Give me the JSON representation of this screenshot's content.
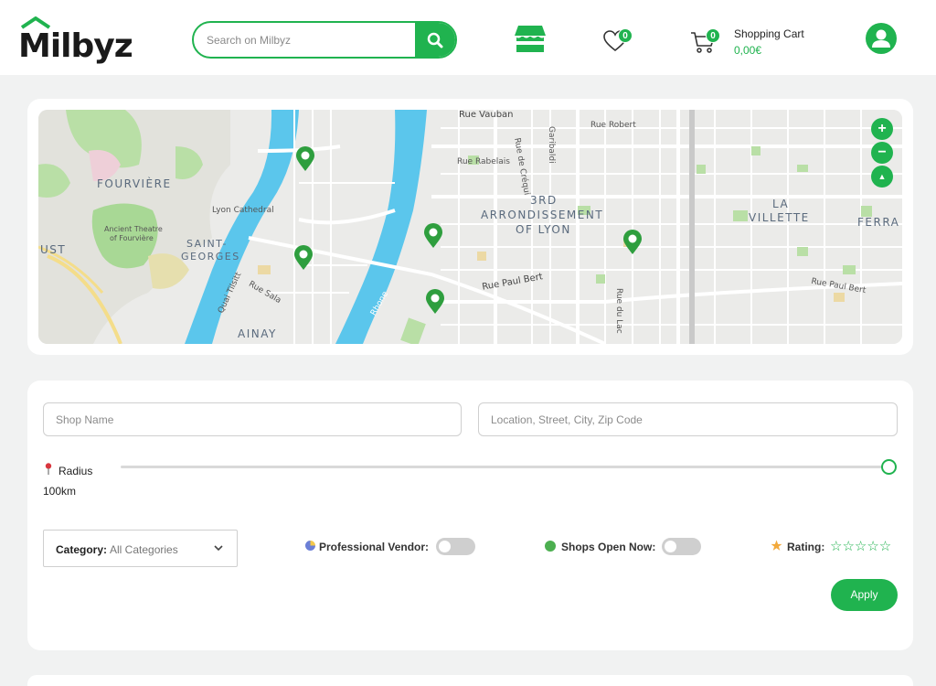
{
  "header": {
    "logo_text": "Milbyz",
    "search_placeholder": "Search on Milbyz",
    "wishlist_count": "0",
    "cart_count": "0",
    "cart_label": "Shopping Cart",
    "cart_total": "0,00€"
  },
  "map": {
    "streets": [
      "Rue Vauban",
      "Rue Robert",
      "Garibaldi",
      "Rue de Créqui",
      "Rue Rabelais",
      "Rue Paul Bert",
      "Rue du Lac",
      "Rue Paul Bert",
      "Quai Tilsitt",
      "Rue Sala",
      "Rhone"
    ],
    "districts": [
      "FOURVIÈRE",
      "3RD",
      "ARRONDISSEMENT",
      "OF LYON",
      "LA",
      "VILLETTE",
      "FERRA",
      "UST",
      "SAINT-",
      "GEORGES",
      "AINAY"
    ],
    "places": [
      "Lyon Cathedral",
      "Ancient Theatre",
      "of Fourvière"
    ],
    "zoom_in": "+",
    "zoom_out": "−",
    "compass": "▲"
  },
  "filters": {
    "shop_name_placeholder": "Shop Name",
    "location_placeholder": "Location, Street, City, Zip Code",
    "radius_label": "Radius",
    "radius_value": "100km",
    "radius_fraction": 1.0,
    "category_label": "Category:",
    "category_value": "All Categories",
    "pro_vendor_label": "Professional Vendor:",
    "pro_vendor_on": false,
    "open_now_label": "Shops Open Now:",
    "open_now_on": false,
    "rating_label": "Rating:",
    "rating_stars": "☆☆☆☆☆",
    "rating_value": 0,
    "apply_label": "Apply"
  },
  "colors": {
    "accent": "#20b34f",
    "water": "#5bc6ec",
    "park": "#9ed58b"
  }
}
